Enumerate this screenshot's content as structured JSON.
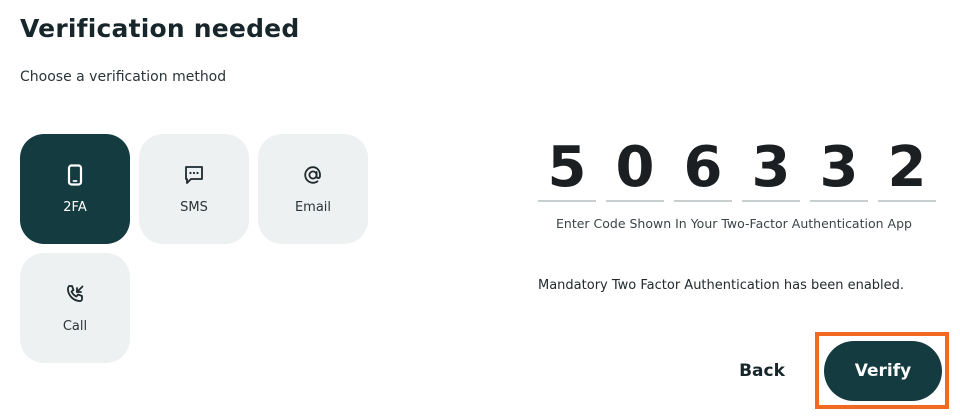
{
  "header": {
    "title": "Verification needed",
    "subtitle": "Choose a verification method"
  },
  "methods": [
    {
      "label": "2FA",
      "icon": "phone-icon",
      "selected": true
    },
    {
      "label": "SMS",
      "icon": "message-icon",
      "selected": false
    },
    {
      "label": "Email",
      "icon": "at-sign-icon",
      "selected": false
    },
    {
      "label": "Call",
      "icon": "phone-call-icon",
      "selected": false
    }
  ],
  "code": {
    "digits": [
      "5",
      "0",
      "6",
      "3",
      "3",
      "2"
    ],
    "hint": "Enter Code Shown In Your Two-Factor Authentication App"
  },
  "status_message": "Mandatory Two Factor Authentication has been enabled.",
  "actions": {
    "back_label": "Back",
    "verify_label": "Verify"
  },
  "colors": {
    "primary": "#143b40",
    "tile_bg": "#eef1f1",
    "highlight": "#f26a21"
  }
}
